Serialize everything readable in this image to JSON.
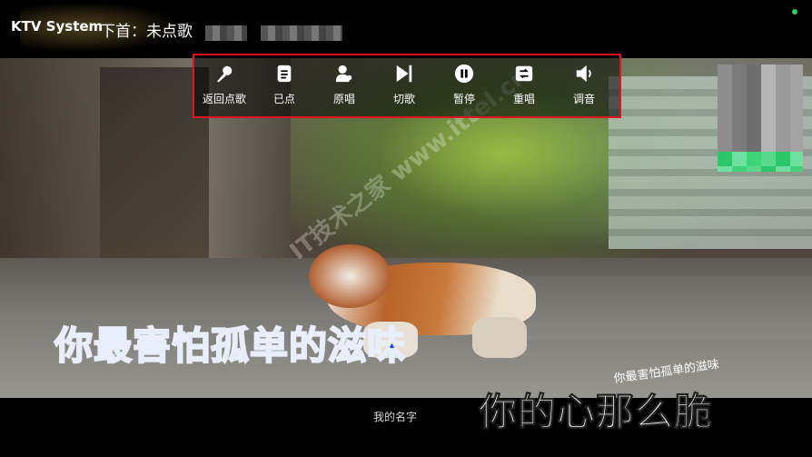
{
  "app": {
    "title": "KTV System",
    "next_song_label": "下首：未点歌",
    "status_color": "#2ecc55"
  },
  "toolbar": {
    "highlight_color": "#e0141e",
    "buttons": [
      {
        "label": "返回点歌",
        "icon": "microphone-icon"
      },
      {
        "label": "已点",
        "icon": "playlist-icon"
      },
      {
        "label": "原唱",
        "icon": "singer-icon"
      },
      {
        "label": "切歌",
        "icon": "skip-next-icon"
      },
      {
        "label": "暂停",
        "icon": "pause-icon"
      },
      {
        "label": "重唱",
        "icon": "replay-icon"
      },
      {
        "label": "调音",
        "icon": "volume-icon"
      }
    ]
  },
  "video": {
    "watermark": "IT技术之家 www.ittel.cn",
    "lyric_current": "你最害怕孤单的滋味",
    "lyric_small": "你最害怕孤单的滋味",
    "lyric_next": "你的心那么脆",
    "song_name": "我的名字",
    "lyric_current_color": "#1f3cff"
  }
}
